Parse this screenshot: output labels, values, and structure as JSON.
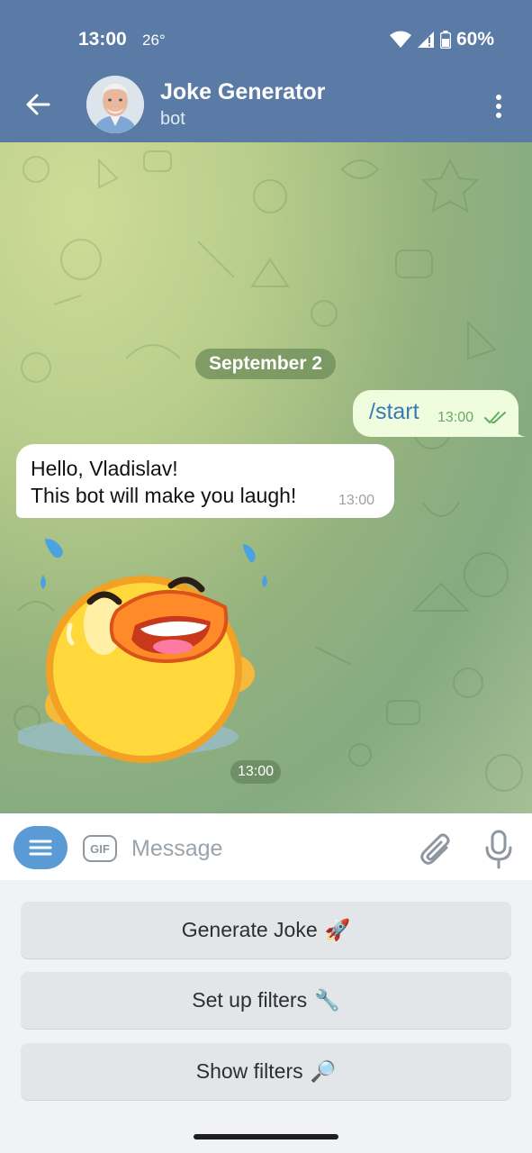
{
  "status_bar": {
    "time": "13:00",
    "temperature": "26°",
    "battery": "60%",
    "icons": [
      "wifi-icon",
      "signal-icon",
      "battery-icon"
    ]
  },
  "header": {
    "title": "Joke Generator",
    "subtitle": "bot",
    "back_icon": "arrow-left-icon",
    "menu_icon": "more-vertical-icon",
    "color": "#5a7ba5"
  },
  "chat": {
    "date_label": "September 2",
    "messages": [
      {
        "direction": "out",
        "text": "/start",
        "time": "13:00",
        "status": "read"
      },
      {
        "direction": "in",
        "lines": [
          "Hello, Vladislav!",
          "This bot will make you laugh!"
        ],
        "time": "13:00"
      },
      {
        "direction": "in",
        "type": "sticker",
        "sticker": "laughing-duck",
        "time": "13:00"
      }
    ]
  },
  "composer": {
    "placeholder": "Message",
    "gif_label": "GIF",
    "icons": [
      "menu-icon",
      "paperclip-icon",
      "microphone-icon"
    ]
  },
  "keyboard": {
    "buttons": [
      {
        "label": "Generate Joke",
        "emoji": "🚀"
      },
      {
        "label": "Set up filters",
        "emoji": "🔧"
      },
      {
        "label": "Show filters",
        "emoji": "🔎"
      }
    ]
  },
  "colors": {
    "accent": "#5b9bd5",
    "outgoing_bubble": "#effdde",
    "incoming_bubble": "#ffffff"
  }
}
